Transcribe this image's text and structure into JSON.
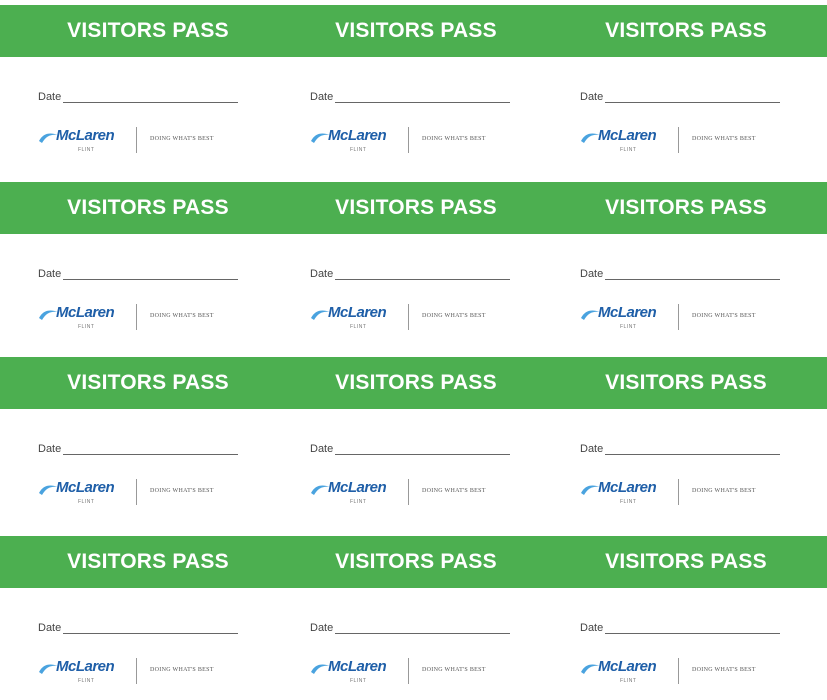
{
  "pass": {
    "title": "VISITORS PASS",
    "date_label": "Date",
    "logo_text": "McLaren",
    "logo_sub": "FLINT",
    "tagline": "DOING WHAT'S BEST"
  },
  "colors": {
    "band_green": "#4caf50",
    "logo_blue": "#1f5fa8"
  }
}
